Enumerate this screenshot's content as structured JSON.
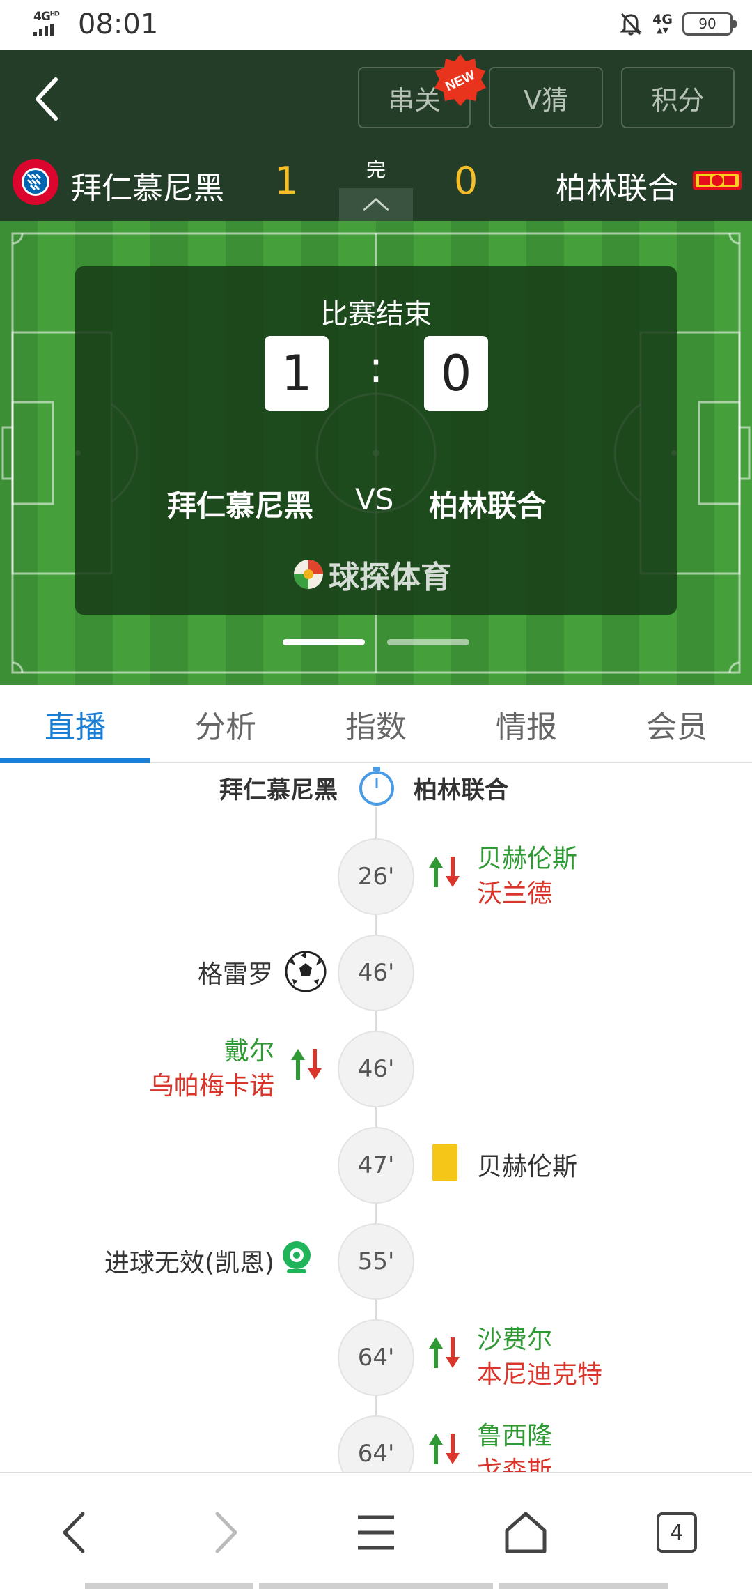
{
  "status_bar": {
    "network": "4G",
    "network_hd": "HD",
    "time": "08:01",
    "network_right": "4G",
    "battery": "90"
  },
  "header": {
    "buttons": {
      "parlay": "串关",
      "guess": "V猜",
      "points": "积分"
    },
    "new_badge": "NEW",
    "home_team": "拜仁慕尼黑",
    "away_team": "柏林联合",
    "home_score": "1",
    "away_score": "0",
    "status": "完"
  },
  "card": {
    "title": "比赛结束",
    "home_score": "1",
    "colon": ":",
    "away_score": "0",
    "home_team": "拜仁慕尼黑",
    "vs": "VS",
    "away_team": "柏林联合",
    "brand": "球探体育"
  },
  "tabs": [
    {
      "label": "直播",
      "active": true
    },
    {
      "label": "分析",
      "active": false
    },
    {
      "label": "指数",
      "active": false
    },
    {
      "label": "情报",
      "active": false
    },
    {
      "label": "会员",
      "active": false
    }
  ],
  "timeline": {
    "home_team": "拜仁慕尼黑",
    "away_team": "柏林联合",
    "events": [
      {
        "minute": "26'",
        "side": "away",
        "type": "substitution",
        "player_in": "贝赫伦斯",
        "player_out": "沃兰德"
      },
      {
        "minute": "46'",
        "side": "home",
        "type": "goal",
        "player": "格雷罗"
      },
      {
        "minute": "46'",
        "side": "home",
        "type": "substitution",
        "player_in": "戴尔",
        "player_out": "乌帕梅卡诺"
      },
      {
        "minute": "47'",
        "side": "away",
        "type": "yellow-card",
        "player": "贝赫伦斯"
      },
      {
        "minute": "55'",
        "side": "home",
        "type": "var",
        "player": "进球无效(凯恩)"
      },
      {
        "minute": "64'",
        "side": "away",
        "type": "substitution",
        "player_in": "沙费尔",
        "player_out": "本尼迪克特"
      },
      {
        "minute": "64'",
        "side": "away",
        "type": "substitution",
        "player_in": "鲁西隆",
        "player_out": "戈森斯"
      }
    ]
  },
  "browser": {
    "tab_count": "4"
  },
  "colors": {
    "header_bg": "#243d28",
    "score": "#f6bf2a",
    "accent": "#1a7fd5",
    "sub_in": "#2f9a34",
    "sub_out": "#d9352b",
    "yellow_card": "#f5c518"
  }
}
